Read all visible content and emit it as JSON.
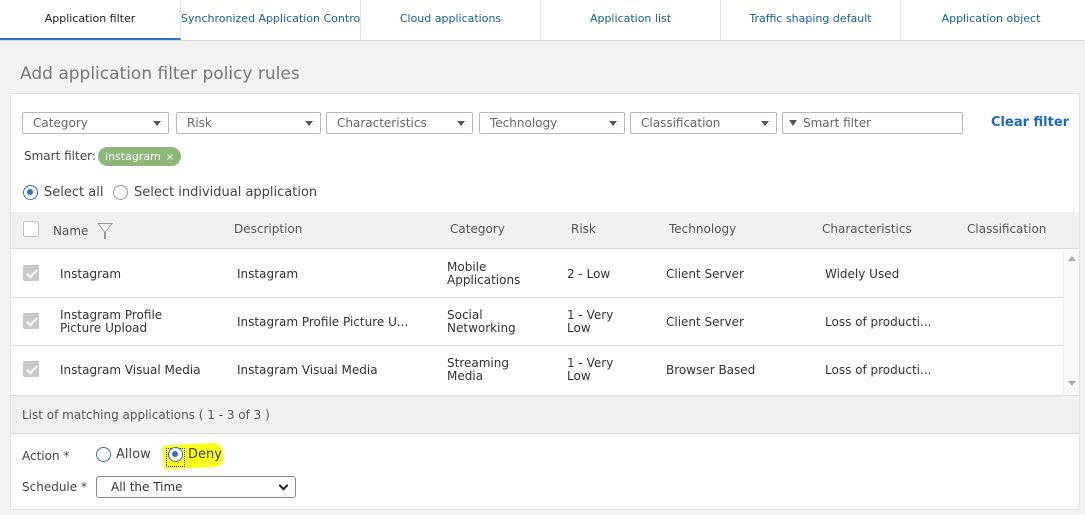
{
  "tabs": [
    {
      "label": "Application filter",
      "active": true
    },
    {
      "label": "Synchronized Application Control"
    },
    {
      "label": "Cloud applications"
    },
    {
      "label": "Application list"
    },
    {
      "label": "Traffic shaping default"
    },
    {
      "label": "Application object"
    }
  ],
  "page_title": "Add application filter policy rules",
  "filters": {
    "category": "Category",
    "risk": "Risk",
    "characteristics": "Characteristics",
    "technology": "Technology",
    "classification": "Classification",
    "smart_filter_placeholder": "Smart filter",
    "clear_filter": "Clear filter"
  },
  "smart_filter": {
    "label": "Smart filter:",
    "chip": "instagram",
    "chip_remove": "×"
  },
  "selection": {
    "select_all": "Select all",
    "select_individual": "Select individual application"
  },
  "table": {
    "headers": {
      "name": "Name",
      "description": "Description",
      "category": "Category",
      "risk": "Risk",
      "technology": "Technology",
      "characteristics": "Characteristics",
      "classification": "Classification"
    },
    "rows": [
      {
        "name": [
          "Instagram"
        ],
        "description": "Instagram",
        "category": [
          "Mobile",
          "Applications"
        ],
        "risk": [
          "2 - Low"
        ],
        "technology": "Client Server",
        "characteristics": "Widely Used",
        "classification": ""
      },
      {
        "name": [
          "Instagram Profile",
          "Picture Upload"
        ],
        "description": "Instagram Profile Picture U...",
        "category": [
          "Social",
          "Networking"
        ],
        "risk": [
          "1 - Very",
          "Low"
        ],
        "technology": "Client Server",
        "characteristics": "Loss of producti...",
        "classification": ""
      },
      {
        "name": [
          "Instagram Visual Media"
        ],
        "description": "Instagram Visual Media",
        "category": [
          "Streaming",
          "Media"
        ],
        "risk": [
          "1 - Very",
          "Low"
        ],
        "technology": "Browser Based",
        "characteristics": "Loss of producti...",
        "classification": ""
      }
    ],
    "footer": "List of matching applications ( 1 - 3 of 3 )"
  },
  "action": {
    "label": "Action *",
    "allow": "Allow",
    "deny": "Deny",
    "selected": "deny"
  },
  "schedule": {
    "label": "Schedule *",
    "value": "All the Time"
  },
  "colors": {
    "accent": "#2a74c4",
    "link": "#1a6bc0",
    "chip": "#8fb878",
    "highlight": "#fbff1c"
  }
}
